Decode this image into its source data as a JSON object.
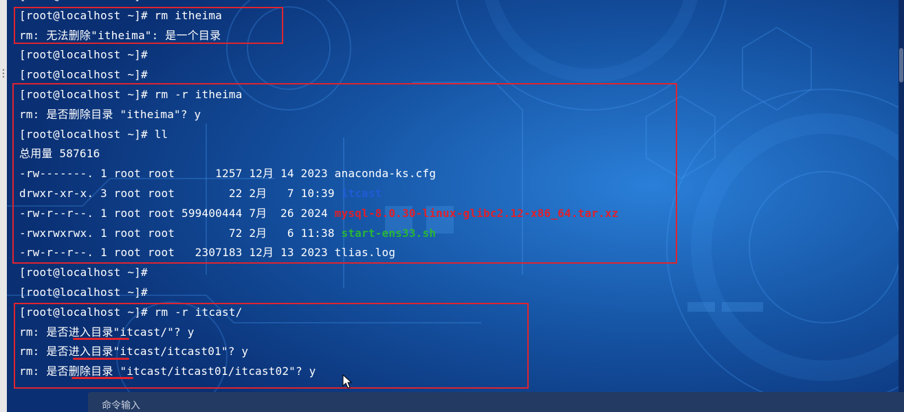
{
  "terminal": {
    "lines": [
      {
        "text": "[root@localhost ~]#"
      },
      {
        "text": "[root@localhost ~]# rm itheima"
      },
      {
        "text": "rm: 无法删除\"itheima\": 是一个目录"
      },
      {
        "text": "[root@localhost ~]#"
      },
      {
        "text": "[root@localhost ~]#"
      },
      {
        "text": "[root@localhost ~]# rm -r itheima"
      },
      {
        "text": "rm: 是否删除目录 \"itheima\"? y"
      },
      {
        "text": "[root@localhost ~]# ll"
      },
      {
        "text": "总用量 587616"
      },
      {
        "text": "-rw-------. 1 root root      1257 12月 14 2023 anaconda-ks.cfg"
      },
      {
        "text": "drwxr-xr-x. 3 root root        22 2月   7 10:39 ",
        "highlight": "itcast",
        "style": "blue"
      },
      {
        "text": "-rw-r--r--. 1 root root 599400444 7月  26 2024 ",
        "highlight": "mysql-8.0.30-linux-glibc2.12-x86_64.tar.xz",
        "style": "red"
      },
      {
        "text": "-rwxrwxrwx. 1 root root        72 2月   6 11:38 ",
        "highlight": "start-ens33.sh",
        "style": "green"
      },
      {
        "text": "-rw-r--r--. 1 root root   2307183 12月 13 2023 tlias.log"
      },
      {
        "text": "[root@localhost ~]#"
      },
      {
        "text": "[root@localhost ~]#"
      },
      {
        "text": "[root@localhost ~]# rm -r itcast/"
      },
      {
        "text": "rm: 是否进入目录\"itcast/\"? y"
      },
      {
        "text": "rm: 是否进入目录\"itcast/itcast01\"? y"
      },
      {
        "text": "rm: 是否删除目录 \"itcast/itcast01/itcast02\"? y"
      }
    ]
  },
  "command_bar": {
    "placeholder": "命令输入"
  },
  "colors": {
    "annotation": "#e0242e",
    "dir_blue": "#1f5bd6",
    "archive_red": "#e0202a",
    "exec_green": "#28b538"
  }
}
